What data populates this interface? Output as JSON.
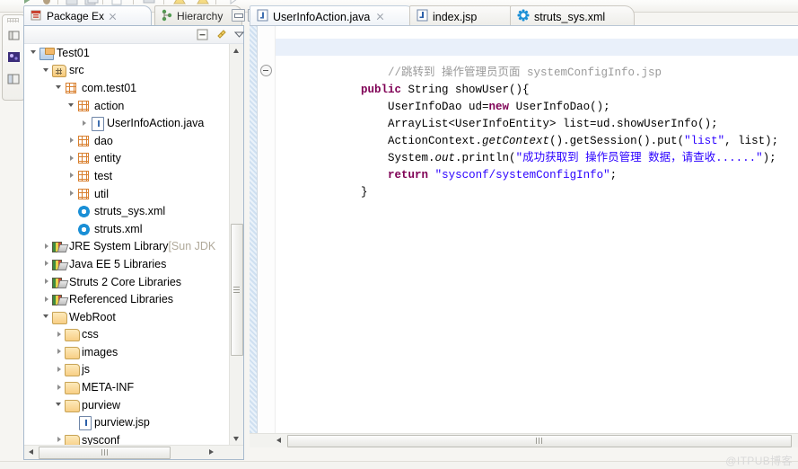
{
  "window": {
    "watermark": "@ITPUB博客"
  },
  "toolbar": {
    "icons": [
      "run-icon",
      "debug-icon",
      "save-icon",
      "save-all-icon",
      "new-wizard-icon",
      "print-icon",
      "search-icon",
      "warning-icon",
      "warning-icon-2",
      "forward-icon"
    ]
  },
  "fastview": {
    "icons": [
      "perspective-icon",
      "welcome-icon",
      "open-perspective-icon"
    ]
  },
  "left_view": {
    "tabs": [
      {
        "label": "Package Ex",
        "icon": "package-explorer-icon",
        "active": true,
        "closable": true
      },
      {
        "label": "Hierarchy",
        "icon": "hierarchy-icon",
        "active": false,
        "closable": false
      }
    ],
    "window_buttons": [
      "minimize-button",
      "maximize-button"
    ],
    "view_toolbar": [
      "collapse-all-icon",
      "link-with-editor-icon",
      "view-menu-icon"
    ],
    "tree": [
      {
        "label": "Test01",
        "icon": "java-project-icon",
        "indent": 0,
        "arrow": "open"
      },
      {
        "label": "src",
        "icon": "source-folder-icon",
        "indent": 1,
        "arrow": "open"
      },
      {
        "label": "com.test01",
        "icon": "package-icon",
        "indent": 2,
        "arrow": "open"
      },
      {
        "label": "action",
        "icon": "package-icon",
        "indent": 3,
        "arrow": "open"
      },
      {
        "label": "UserInfoAction.java",
        "icon": "java-file-icon",
        "indent": 4,
        "arrow": "closed"
      },
      {
        "label": "dao",
        "icon": "package-icon",
        "indent": 3,
        "arrow": "closed"
      },
      {
        "label": "entity",
        "icon": "package-icon",
        "indent": 3,
        "arrow": "closed"
      },
      {
        "label": "test",
        "icon": "package-icon",
        "indent": 3,
        "arrow": "closed"
      },
      {
        "label": "util",
        "icon": "package-icon",
        "indent": 3,
        "arrow": "closed"
      },
      {
        "label": "struts_sys.xml",
        "icon": "xml-file-icon",
        "indent": 3,
        "arrow": "none"
      },
      {
        "label": "struts.xml",
        "icon": "xml-file-icon",
        "indent": 3,
        "arrow": "none"
      },
      {
        "label": "JRE System Library",
        "suffix": " [Sun JDK",
        "icon": "library-icon",
        "indent": 1,
        "arrow": "closed"
      },
      {
        "label": "Java EE 5 Libraries",
        "icon": "library-icon",
        "indent": 1,
        "arrow": "closed"
      },
      {
        "label": "Struts 2 Core Libraries",
        "icon": "library-icon",
        "indent": 1,
        "arrow": "closed"
      },
      {
        "label": "Referenced Libraries",
        "icon": "library-icon",
        "indent": 1,
        "arrow": "closed"
      },
      {
        "label": "WebRoot",
        "icon": "folder-icon",
        "indent": 1,
        "arrow": "open"
      },
      {
        "label": "css",
        "icon": "folder-icon",
        "indent": 2,
        "arrow": "closed"
      },
      {
        "label": "images",
        "icon": "folder-icon",
        "indent": 2,
        "arrow": "closed"
      },
      {
        "label": "js",
        "icon": "folder-icon",
        "indent": 2,
        "arrow": "closed"
      },
      {
        "label": "META-INF",
        "icon": "folder-icon",
        "indent": 2,
        "arrow": "closed"
      },
      {
        "label": "purview",
        "icon": "folder-icon",
        "indent": 2,
        "arrow": "open"
      },
      {
        "label": "purview.jsp",
        "icon": "jsp-file-icon",
        "indent": 3,
        "arrow": "none"
      },
      {
        "label": "sysconf",
        "icon": "folder-icon",
        "indent": 2,
        "arrow": "closed"
      }
    ]
  },
  "editor": {
    "tabs": [
      {
        "label": "UserInfoAction.java",
        "icon": "java-file-icon",
        "active": true,
        "closable": true
      },
      {
        "label": "index.jsp",
        "icon": "jsp-file-icon",
        "active": false,
        "closable": false
      },
      {
        "label": "struts_sys.xml",
        "icon": "xml-file-icon",
        "active": false,
        "closable": false
      }
    ],
    "code_lines": [
      "",
      "    //跳转到 操作管理员页面 systemConfigInfo.jsp",
      "    public String showUser(){",
      "        UserInfoDao ud=new UserInfoDao();",
      "        ArrayList<UserInfoEntity> list=ud.showUserInfo();",
      "        ActionContext.getContext().getSession().put(\"list\", list);",
      "        System.out.println(\"成功获取到 操作员管理 数据，请查收......\");",
      "        return \"sysconf/systemConfigInfo\";",
      "    }"
    ],
    "highlighted_line_index": 0,
    "colors": {
      "keyword": "#7f0055",
      "string": "#2a00ff",
      "comment": "#9a9a9a",
      "background": "#ffffff",
      "current_line": "#e9f0fa"
    }
  }
}
